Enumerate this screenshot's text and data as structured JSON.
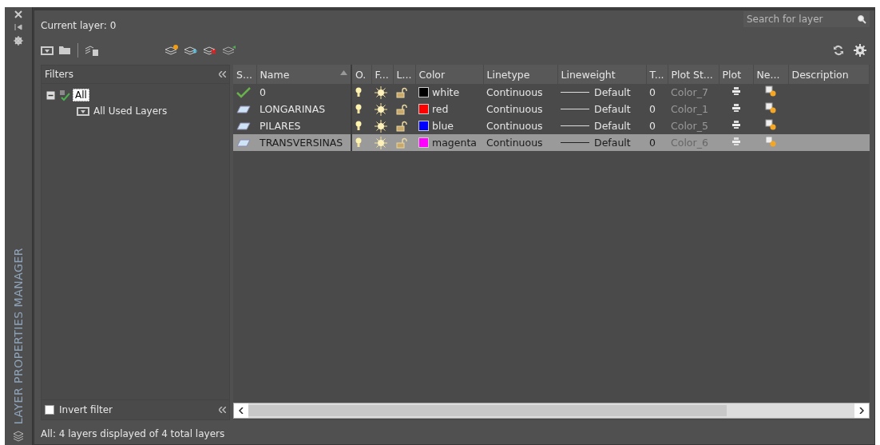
{
  "palette": {
    "title": "LAYER PROPERTIES MANAGER"
  },
  "header": {
    "current_layer": "Current layer: 0",
    "search": {
      "placeholder": "Search for layer"
    }
  },
  "filters": {
    "title": "Filters",
    "tree": [
      {
        "label": "All",
        "selected": true,
        "expanded": true,
        "children": [
          {
            "label": "All Used Layers",
            "selected": false
          }
        ]
      }
    ],
    "invert_filter": {
      "label": "Invert filter",
      "checked": false
    }
  },
  "table": {
    "columns": [
      "S...",
      "Name",
      "O.",
      "F...",
      "L...",
      "Color",
      "Linetype",
      "Lineweight",
      "T...",
      "Plot St...",
      "Plot",
      "Ne...",
      "Description"
    ],
    "rows": [
      {
        "kind": "current",
        "name": "0",
        "on": true,
        "frozen": false,
        "locked": false,
        "color": "#000000",
        "color_name": "white",
        "linetype": "Continuous",
        "lineweight": "Default",
        "transparency": "0",
        "plot_style": "Color_7",
        "plot": true,
        "new_vp_frozen": false,
        "selected": false
      },
      {
        "kind": "layer",
        "name": "LONGARINAS",
        "on": true,
        "frozen": false,
        "locked": false,
        "color": "#ff0000",
        "color_name": "red",
        "linetype": "Continuous",
        "lineweight": "Default",
        "transparency": "0",
        "plot_style": "Color_1",
        "plot": true,
        "new_vp_frozen": false,
        "selected": false
      },
      {
        "kind": "layer",
        "name": "PILARES",
        "on": true,
        "frozen": false,
        "locked": false,
        "color": "#0000ff",
        "color_name": "blue",
        "linetype": "Continuous",
        "lineweight": "Default",
        "transparency": "0",
        "plot_style": "Color_5",
        "plot": true,
        "new_vp_frozen": false,
        "selected": false
      },
      {
        "kind": "layer",
        "name": "TRANSVERSINAS",
        "on": true,
        "frozen": false,
        "locked": false,
        "color": "#ff00ff",
        "color_name": "magenta",
        "linetype": "Continuous",
        "lineweight": "Default",
        "transparency": "0",
        "plot_style": "Color_6",
        "plot": true,
        "new_vp_frozen": false,
        "selected": true
      }
    ]
  },
  "status_bar": "All: 4 layers displayed of 4 total layers"
}
